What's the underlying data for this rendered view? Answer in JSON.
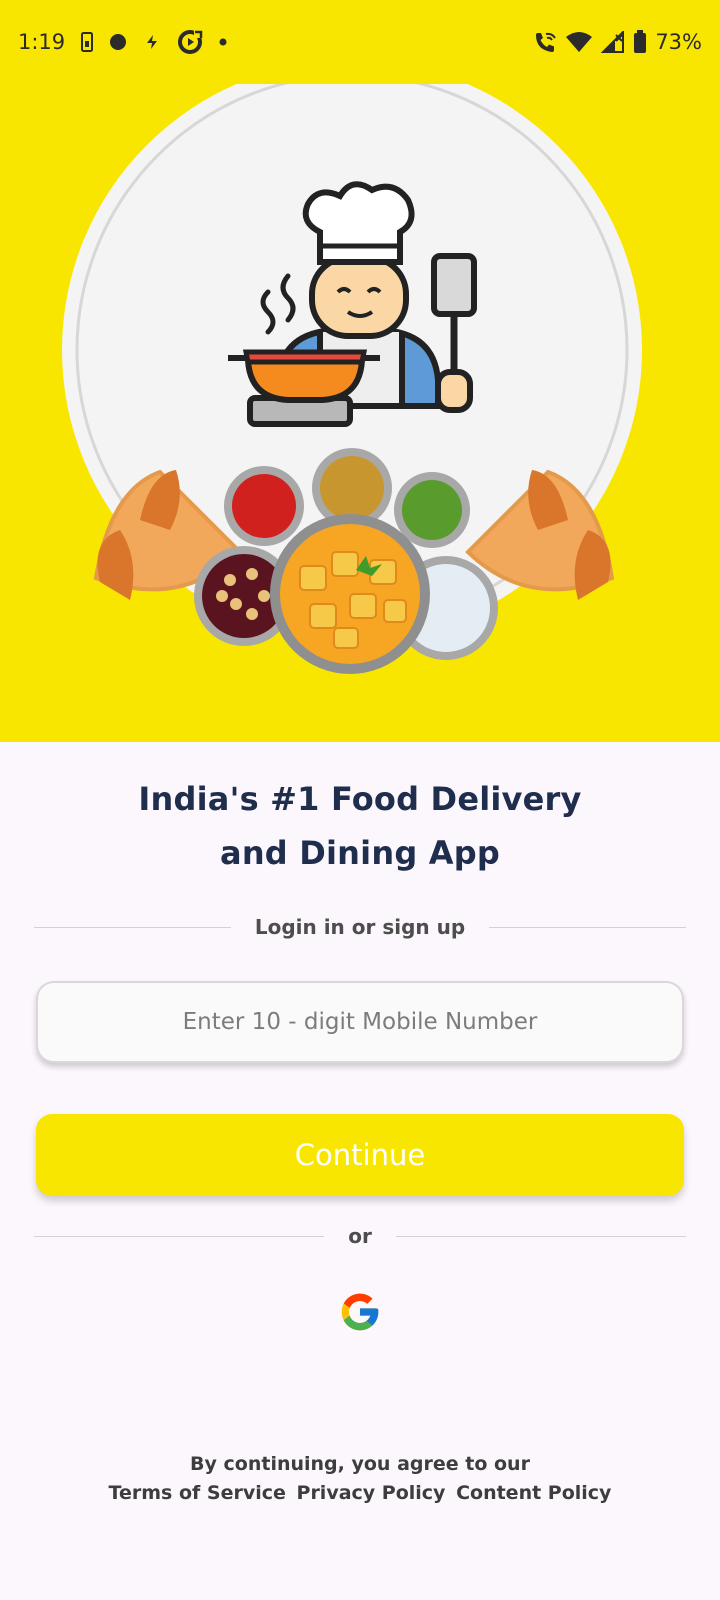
{
  "status_bar": {
    "time": "1:19",
    "battery": "73%",
    "left_icons": [
      "sim-card-icon",
      "circle-notification-icon",
      "flash-icon",
      "sync-icon",
      "dot-icon"
    ],
    "right_icons": [
      "wifi-calling-icon",
      "wifi-icon",
      "signal-icon",
      "battery-icon"
    ]
  },
  "hero": {
    "background_color": "#f9e600",
    "illustration": "chef-cooking-with-indian-food-icon"
  },
  "headline": {
    "line1": "India's #1 Food Delivery",
    "line2": "and Dining App"
  },
  "login": {
    "divider_text": "Login in or sign up",
    "phone_placeholder": "Enter 10 - digit Mobile Number",
    "phone_value": "",
    "continue_label": "Continue",
    "or_text": "or",
    "google_icon": "google-g-icon"
  },
  "footer": {
    "agree_text": "By continuing, you agree to our",
    "terms_link": "Terms of Service",
    "privacy_link": "Privacy Policy",
    "content_link": "Content Policy"
  },
  "colors": {
    "accent": "#f9e600",
    "headline": "#1f2e4d",
    "background": "#fcf7fd"
  }
}
